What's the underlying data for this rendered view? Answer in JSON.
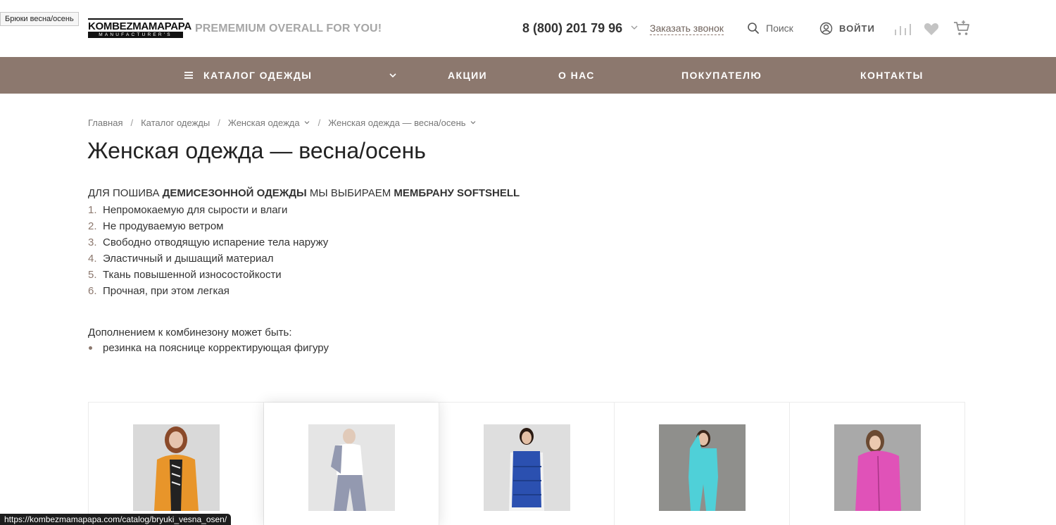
{
  "tooltip": "Брюки весна/осень",
  "header": {
    "logo_top": "KOMBEZMAMAPAPA",
    "logo_bottom": "MANUFACTURER'S",
    "slogan": "PREMEMIUM OVERALL FOR YOU!",
    "phone": "8 (800) 201 79 96",
    "callback": "Заказать звонок",
    "search": "Поиск",
    "login": "ВОЙТИ"
  },
  "nav": {
    "catalog": "КАТАЛОГ ОДЕЖДЫ",
    "sale": "АКЦИИ",
    "about": "О НАС",
    "buyer": "ПОКУПАТЕЛЮ",
    "contacts": "КОНТАКТЫ"
  },
  "breadcrumb": [
    "Главная",
    "Каталог одежды",
    "Женская одежда",
    "Женская одежда — весна/осень"
  ],
  "page_title": "Женская одежда — весна/осень",
  "intro": {
    "p1": "ДЛЯ ПОШИВА ",
    "b1": "ДЕМИСЕЗОННОЙ ОДЕЖДЫ",
    "p2": " МЫ ВЫБИРАЕМ ",
    "b2": "МЕМБРАНУ SOFTSHELL"
  },
  "features": [
    {
      "num": "1.",
      "text": "Непромокаемую для сырости и влаги"
    },
    {
      "num": "2.",
      "text": "Не продуваемую ветром"
    },
    {
      "num": "3.",
      "text": "Свободно отводящую испарение тела наружу"
    },
    {
      "num": "4.",
      "text": "Эластичный и дышащий материал"
    },
    {
      "num": "5.",
      "text": "Ткань повышенной износостойкости"
    },
    {
      "num": "6.",
      "text": "Прочная, при этом легкая"
    }
  ],
  "addon": {
    "title": "Дополнением к комбинезону может быть:",
    "item": "резинка на пояснице корректирующая фигуру"
  },
  "products": [
    {
      "garment_color": "#e8952a",
      "bg": "#d9d9d9"
    },
    {
      "garment_color": "#3b4670",
      "bg": "#d0d0d0"
    },
    {
      "garment_color": "#2b50b0",
      "bg": "#dedede"
    },
    {
      "garment_color": "#4fd0d8",
      "bg": "#8f8f8c"
    },
    {
      "garment_color": "#e052b8",
      "bg": "#a9a9a9"
    }
  ],
  "status_url": "https://kombezmamapapa.com/catalog/bryuki_vesna_osen/",
  "colors": {
    "accent": "#8c786e",
    "text": "#333333"
  }
}
